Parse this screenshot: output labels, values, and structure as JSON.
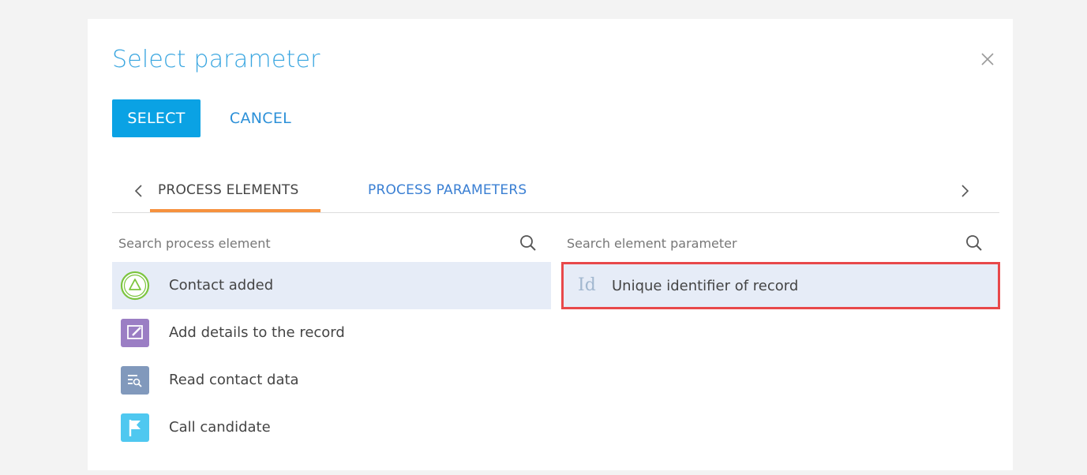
{
  "dialog": {
    "title": "Select parameter",
    "close_icon": "close-icon"
  },
  "toolbar": {
    "select_label": "SELECT",
    "cancel_label": "CANCEL"
  },
  "tabs": [
    {
      "label": "PROCESS ELEMENTS",
      "active": true
    },
    {
      "label": "PROCESS PARAMETERS",
      "active": false
    }
  ],
  "search_elements": {
    "placeholder": "Search process element",
    "value": ""
  },
  "search_parameters": {
    "placeholder": "Search element parameter",
    "value": ""
  },
  "process_elements": [
    {
      "label": "Contact added",
      "icon": "start-signal-icon",
      "selected": true
    },
    {
      "label": "Add details to the record",
      "icon": "edit-record-icon",
      "selected": false
    },
    {
      "label": "Read contact data",
      "icon": "read-data-icon",
      "selected": false
    },
    {
      "label": "Call candidate",
      "icon": "flag-icon",
      "selected": false
    }
  ],
  "element_parameters": [
    {
      "icon_text": "Id",
      "label": "Unique identifier of record",
      "selected": true
    }
  ],
  "colors": {
    "accent": "#0aa2e4",
    "title": "#3aa6e0",
    "link": "#3a7fd3",
    "tab_underline": "#f6913e",
    "selected_row": "#e6ecf7",
    "highlight_border": "#e8484a"
  }
}
